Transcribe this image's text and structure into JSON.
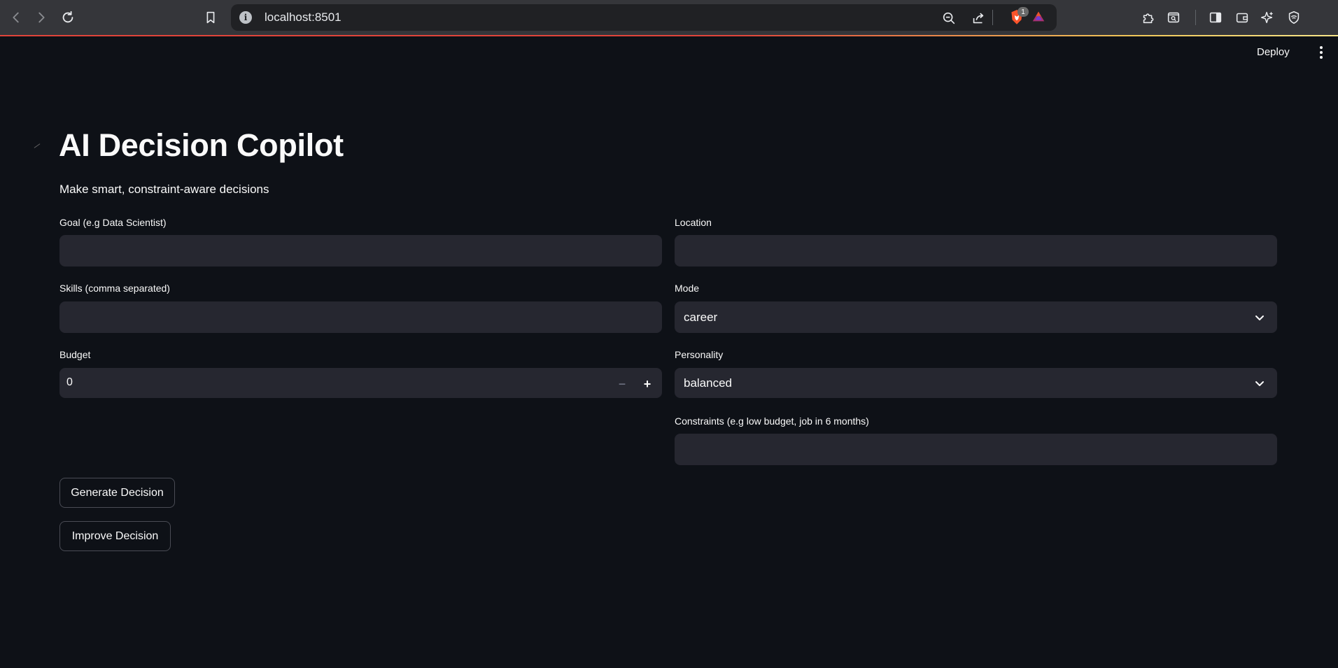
{
  "browser": {
    "url": "localhost:8501",
    "info_glyph": "i",
    "brave_shields_count": "1",
    "icons": [
      "back-icon",
      "forward-icon",
      "reload-icon",
      "bookmark-icon",
      "zoom-icon",
      "share-icon",
      "brave-shield-icon",
      "brave-rewards-icon",
      "extensions-icon",
      "page-search-icon",
      "sidebar-icon",
      "wallet-icon",
      "leo-ai-icon",
      "vpn-icon"
    ]
  },
  "header": {
    "deploy_label": "Deploy"
  },
  "main": {
    "title": "AI Decision Copilot",
    "subtitle": "Make smart, constraint-aware decisions"
  },
  "form": {
    "goal": {
      "label": "Goal (e.g Data Scientist)",
      "value": ""
    },
    "location": {
      "label": "Location",
      "value": ""
    },
    "skills": {
      "label": "Skills (comma separated)",
      "value": ""
    },
    "mode": {
      "label": "Mode",
      "value": "career"
    },
    "budget": {
      "label": "Budget",
      "value": "0",
      "minus": "−",
      "plus": "+"
    },
    "personality": {
      "label": "Personality",
      "value": "balanced"
    },
    "constraints": {
      "label": "Constraints (e.g low budget, job in 6 months)",
      "value": ""
    }
  },
  "actions": {
    "generate_label": "Generate Decision",
    "improve_label": "Improve Decision"
  },
  "colors": {
    "background": "#0e1117",
    "input_bg": "#262730",
    "text": "#fafafa",
    "chrome_bg": "#35363a",
    "accent_line": "#e0443a"
  }
}
